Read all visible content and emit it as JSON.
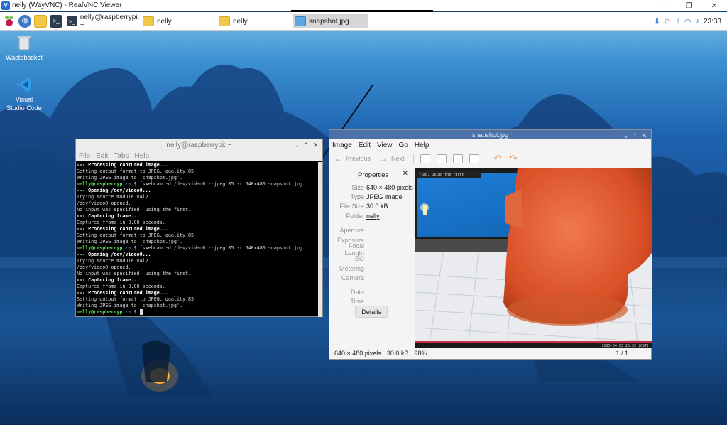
{
  "host": {
    "title": "nelly (WayVNC) - RealVNC Viewer",
    "icon": "realvnc-icon",
    "controls": [
      "—",
      "❐",
      "✕"
    ]
  },
  "taskbar": {
    "launchers": [
      "raspberry-menu-icon",
      "web-browser-icon",
      "file-manager-icon",
      "terminal-icon"
    ],
    "tasks": [
      {
        "label": "nelly@raspberrypi: ~",
        "icon": "terminal-icon",
        "active": false
      },
      {
        "label": "nelly",
        "icon": "folder-icon",
        "active": false
      },
      {
        "label": "nelly",
        "icon": "folder-icon",
        "active": false
      },
      {
        "label": "snapshot.jpg",
        "icon": "image-icon",
        "active": true
      }
    ],
    "tray": [
      "download-icon",
      "sync-icon",
      "bluetooth-icon",
      "wifi-icon",
      "volume-icon"
    ],
    "clock": "23:33"
  },
  "desktop": {
    "icons": [
      {
        "label": "Wastebasket",
        "icon": "wastebasket-icon"
      },
      {
        "label": "Visual Studio Code",
        "icon": "vscode-icon"
      }
    ]
  },
  "terminal": {
    "title": "nelly@raspberrypi: ~",
    "menu": [
      "File",
      "Edit",
      "Tabs",
      "Help"
    ],
    "prompt_user": "nelly@raspberrypi",
    "prompt_path": ":~ $",
    "lines": [
      {
        "kind": "h",
        "text": "--- Processing captured image..."
      },
      {
        "kind": "o",
        "text": "Setting output format to JPEG, quality 85"
      },
      {
        "kind": "o",
        "text": "Writing JPEG image to 'snapshot.jpg'."
      },
      {
        "kind": "c",
        "text": " fswebcam -d /dev/video0 --jpeg 85 -r 640x480 snapshot.jpg"
      },
      {
        "kind": "h",
        "text": "--- Opening /dev/video0..."
      },
      {
        "kind": "o",
        "text": "Trying source module v4l2..."
      },
      {
        "kind": "o",
        "text": "/dev/video0 opened."
      },
      {
        "kind": "o",
        "text": "No input was specified, using the first."
      },
      {
        "kind": "h",
        "text": "--- Capturing frame..."
      },
      {
        "kind": "o",
        "text": "Captured frame in 0.00 seconds."
      },
      {
        "kind": "h",
        "text": "--- Processing captured image..."
      },
      {
        "kind": "o",
        "text": "Setting output format to JPEG, quality 85"
      },
      {
        "kind": "o",
        "text": "Writing JPEG image to 'snapshot.jpg'."
      },
      {
        "kind": "c",
        "text": " fswebcam -d /dev/video0 --jpeg 85 -r 640x480 snapshot.jpg"
      },
      {
        "kind": "h",
        "text": "--- Opening /dev/video0..."
      },
      {
        "kind": "o",
        "text": "Trying source module v4l2..."
      },
      {
        "kind": "o",
        "text": "/dev/video0 opened."
      },
      {
        "kind": "o",
        "text": "No input was specified, using the first."
      },
      {
        "kind": "h",
        "text": "--- Capturing frame..."
      },
      {
        "kind": "o",
        "text": "Captured frame in 0.00 seconds."
      },
      {
        "kind": "h",
        "text": "--- Processing captured image..."
      },
      {
        "kind": "o",
        "text": "Setting output format to JPEG, quality 85"
      },
      {
        "kind": "o",
        "text": "Writing JPEG image to 'snapshot.jpg'."
      },
      {
        "kind": "p",
        "text": " "
      }
    ]
  },
  "viewer": {
    "title": "snapshot.jpg",
    "menu": [
      "Image",
      "Edit",
      "View",
      "Go",
      "Help"
    ],
    "toolbar": {
      "previous": "Previous",
      "next": "Next"
    },
    "properties": {
      "heading": "Properties",
      "rows": [
        {
          "k": "Size",
          "v": "640 × 480 pixels"
        },
        {
          "k": "Type",
          "v": "JPEG image"
        },
        {
          "k": "File Size",
          "v": "30.0 kB"
        },
        {
          "k": "Folder",
          "v": "nelly"
        }
      ],
      "meta": [
        "Aperture",
        "Exposure",
        "Focal Length",
        "ISO",
        "Metering",
        "Camera"
      ],
      "meta2": [
        "Date",
        "Time"
      ],
      "details_label": "Details"
    },
    "status": {
      "dims": "640 × 480 pixels",
      "size": "30.0 kB",
      "zoom": "98%",
      "page": "1 / 1"
    },
    "photo": {
      "screen_text": "fied, using the first",
      "timestamp": "2025-04-03 23:33 (CST)"
    }
  }
}
